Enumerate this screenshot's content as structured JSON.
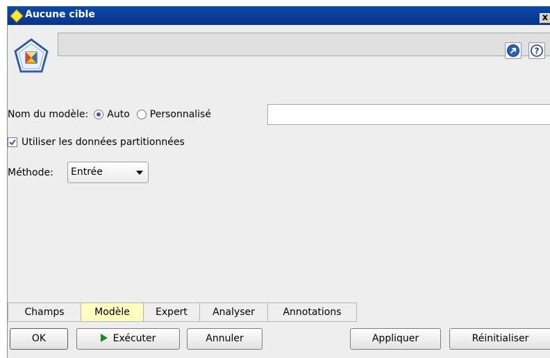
{
  "window": {
    "title": "Aucune cible",
    "close_glyph": "x"
  },
  "header": {
    "node_icon": "model-node-icon",
    "launch_icon": "launch-arrow-icon",
    "help_icon": "help-icon"
  },
  "form": {
    "model_name_label": "Nom du modèle:",
    "radio_auto_label": "Auto",
    "radio_custom_label": "Personnalisé",
    "selected_radio": "Auto",
    "custom_name_value": "",
    "use_partitioned_label": "Utiliser les données partitionnées",
    "use_partitioned_checked": true,
    "method_label": "Méthode:",
    "method_value": "Entrée"
  },
  "tabs": [
    {
      "label": "Champs",
      "active": false
    },
    {
      "label": "Modèle",
      "active": true
    },
    {
      "label": "Expert",
      "active": false
    },
    {
      "label": "Analyser",
      "active": false
    },
    {
      "label": "Annotations",
      "active": false
    }
  ],
  "buttons": {
    "ok": "OK",
    "run": "Exécuter",
    "cancel": "Annuler",
    "apply": "Appliquer",
    "reset": "Réinitialiser"
  },
  "colors": {
    "titlebar": "#0a3c96",
    "active_tab": "#fffcc0",
    "run_icon": "#1d8a1d"
  }
}
